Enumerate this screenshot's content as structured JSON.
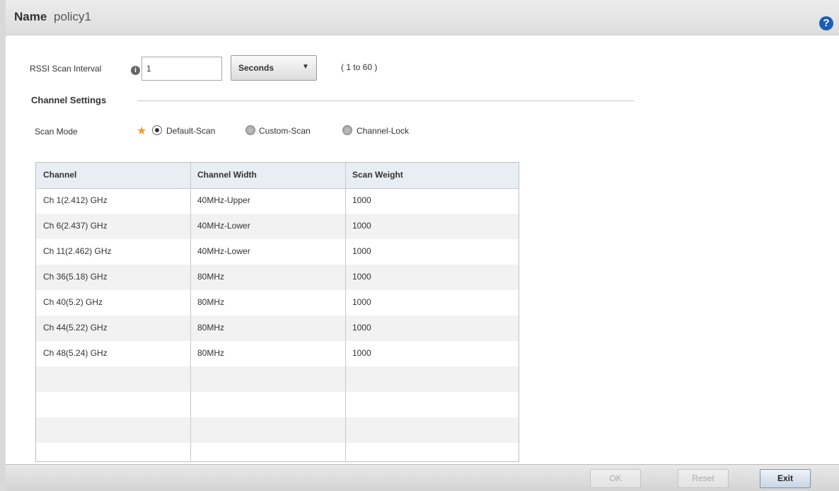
{
  "header": {
    "name_label": "Name",
    "name_value": "policy1",
    "help_icon": "question-circle-icon"
  },
  "rssi": {
    "label": "RSSI Scan Interval",
    "info_icon": "info-icon",
    "value": "1",
    "unit": "Seconds",
    "range": "( 1 to 60 )"
  },
  "channel_settings": {
    "title": "Channel Settings",
    "scan_mode_label": "Scan Mode",
    "required_mark": "★",
    "options": [
      {
        "label": "Default-Scan",
        "selected": true
      },
      {
        "label": "Custom-Scan",
        "selected": false
      },
      {
        "label": "Channel-Lock",
        "selected": false
      }
    ]
  },
  "table": {
    "columns": [
      "Channel",
      "Channel Width",
      "Scan Weight"
    ],
    "rows": [
      [
        "Ch 1(2.412) GHz",
        "40MHz-Upper",
        "1000"
      ],
      [
        "Ch 6(2.437) GHz",
        "40MHz-Lower",
        "1000"
      ],
      [
        "Ch 11(2.462) GHz",
        "40MHz-Lower",
        "1000"
      ],
      [
        "Ch 36(5.18) GHz",
        "80MHz",
        "1000"
      ],
      [
        "Ch 40(5.2) GHz",
        "80MHz",
        "1000"
      ],
      [
        "Ch 44(5.22) GHz",
        "80MHz",
        "1000"
      ],
      [
        "Ch 48(5.24) GHz",
        "80MHz",
        "1000"
      ]
    ]
  },
  "footer": {
    "ok_label": "OK",
    "reset_label": "Reset",
    "exit_label": "Exit"
  },
  "colors": {
    "accent": "#1a5fb4",
    "required": "#f0a030"
  }
}
